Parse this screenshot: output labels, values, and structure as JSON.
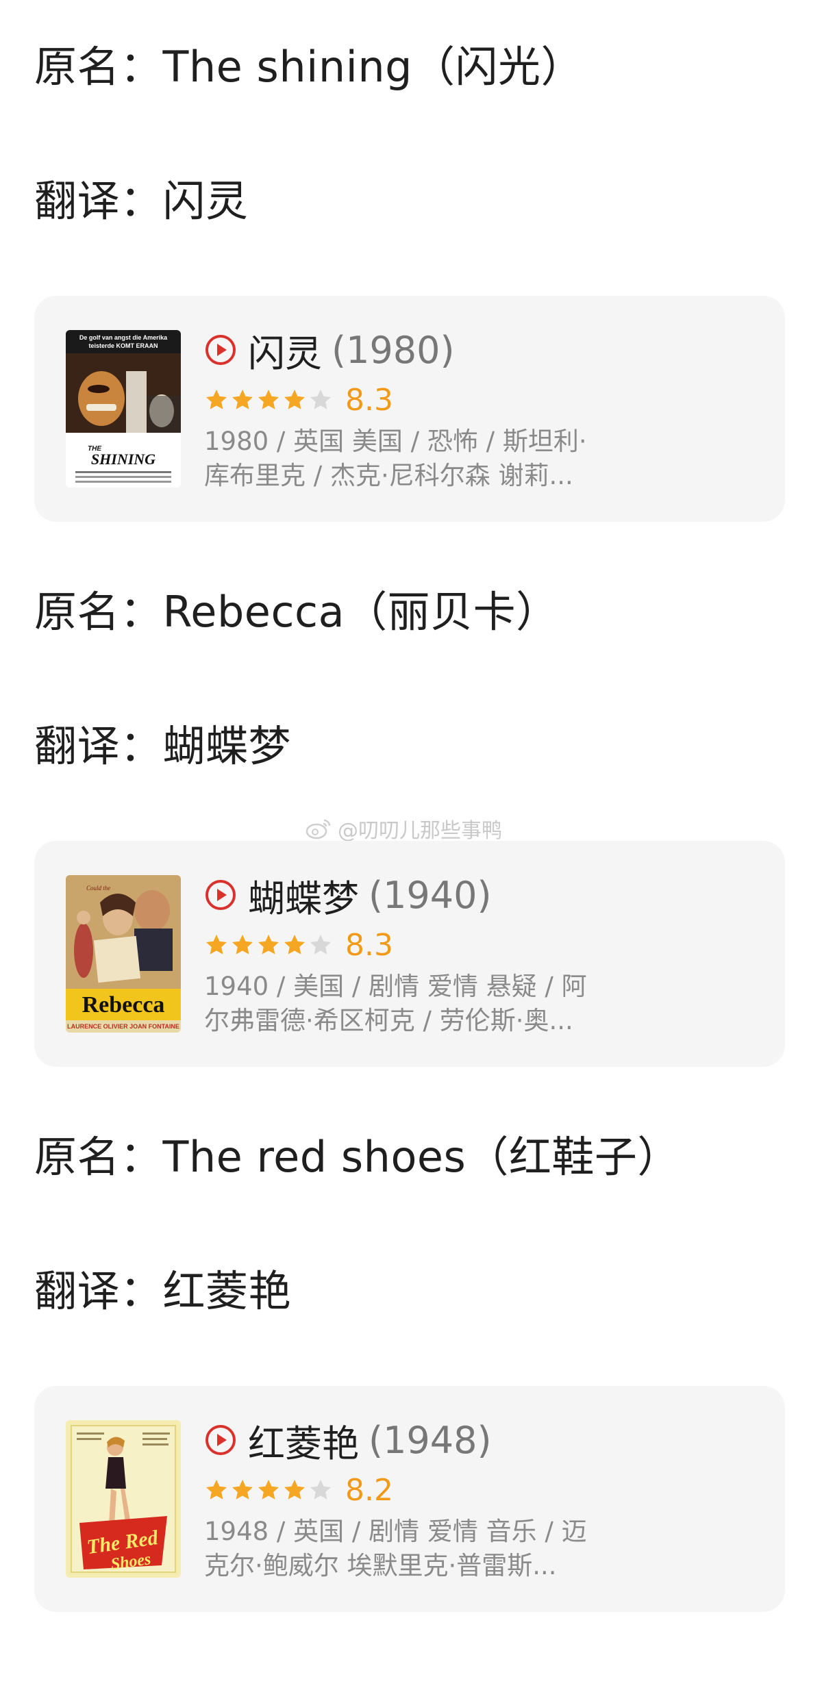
{
  "entries": [
    {
      "original_label": "原名：",
      "original_value": "The shining（闪光）",
      "translation_label": "翻译：",
      "translation_value": "闪灵",
      "card": {
        "title": "闪灵",
        "year": "(1980)",
        "rating": "8.3",
        "stars_filled": 4,
        "meta_line1": "1980 / 英国 美国 / 恐怖 / 斯坦利·",
        "meta_line2": "库布里克 / 杰克·尼科尔森 谢莉...",
        "poster_text_top": "De golf van angst die Amerika teisterde KOMT ERAAN",
        "poster_title": "THE SHINING"
      }
    },
    {
      "original_label": "原名：",
      "original_value": "Rebecca（丽贝卡）",
      "translation_label": "翻译：",
      "translation_value": "蝴蝶梦",
      "card": {
        "title": "蝴蝶梦",
        "year": "(1940)",
        "rating": "8.3",
        "stars_filled": 4,
        "meta_line1": "1940 / 美国 / 剧情 爱情 悬疑 / 阿",
        "meta_line2": "尔弗雷德·希区柯克 / 劳伦斯·奥...",
        "poster_title": "Rebecca",
        "poster_credits": "LAURENCE OLIVIER  JOAN FONTAINE"
      }
    },
    {
      "original_label": "原名：",
      "original_value": "The red shoes（红鞋子）",
      "translation_label": "翻译：",
      "translation_value": "红菱艳",
      "card": {
        "title": "红菱艳",
        "year": "(1948)",
        "rating": "8.2",
        "stars_filled": 4,
        "meta_line1": "1948 / 英国 / 剧情 爱情 音乐 / 迈",
        "meta_line2": "克尔·鲍威尔 埃默里克·普雷斯...",
        "poster_title": "The Red Shoes"
      }
    }
  ],
  "watermark": "@叨叨儿那些事鸭",
  "colors": {
    "star_filled": "#f5a623",
    "star_empty": "#d8d8d8",
    "score": "#f29a17",
    "play_icon": "#d9312b",
    "card_bg": "#f5f5f5"
  }
}
